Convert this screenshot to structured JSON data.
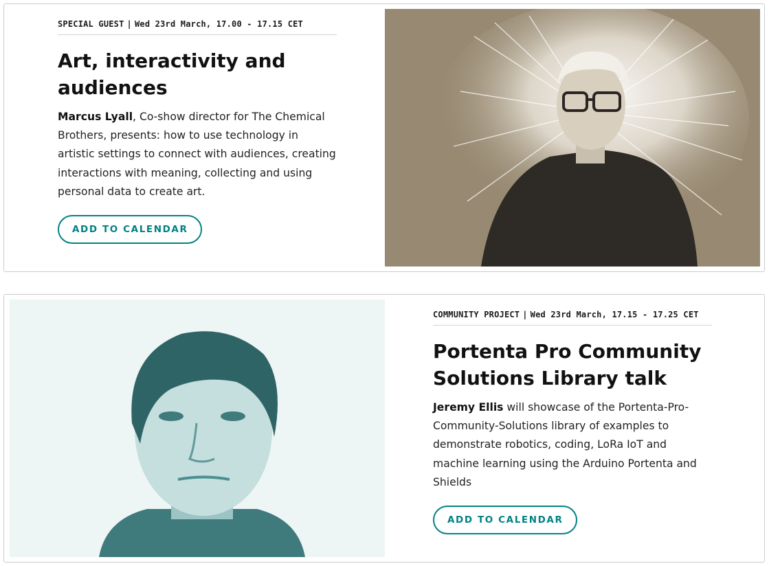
{
  "events": [
    {
      "category": "SPECIAL GUEST",
      "separator": "|",
      "datetime": "Wed 23rd March, 17.00 - 17.15 CET",
      "title": "Art, interactivity and audiences",
      "speaker": "Marcus Lyall",
      "description": ", Co-show director for The Chemical Brothers, presents: how to use technology in artistic settings to connect with audiences, creating interactions with meaning, collecting and using personal data to create art.",
      "button_label": "ADD TO CALENDAR",
      "photo_tint": "#988a72"
    },
    {
      "category": "COMMUNITY PROJECT",
      "separator": "|",
      "datetime": "Wed 23rd March, 17.15 - 17.25 CET",
      "title": "Portenta Pro Community Solutions Library talk",
      "speaker": "Jeremy Ellis",
      "description": " will showcase of the Portenta-Pro-Community-Solutions library of examples to demonstrate robotics, coding, LoRa IoT and machine learning using the Arduino Portenta and Shields",
      "button_label": "ADD TO CALENDAR",
      "photo_tint": "#4a8f92"
    }
  ],
  "colors": {
    "accent": "#008184",
    "border": "#c9cccd",
    "text": "#1a1a1a"
  }
}
